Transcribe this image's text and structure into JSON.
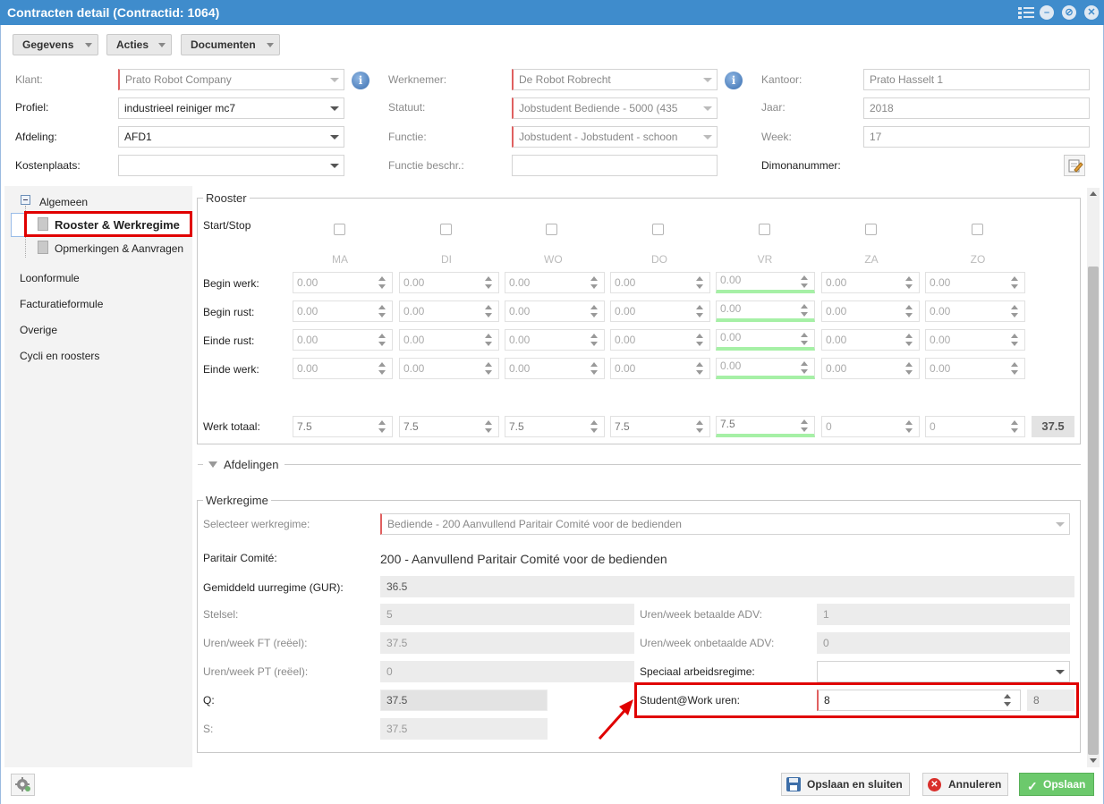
{
  "window": {
    "title": "Contracten detail (Contractid: 1064)"
  },
  "toolbar": {
    "gegevens": "Gegevens",
    "acties": "Acties",
    "documenten": "Documenten"
  },
  "form": {
    "klant_label": "Klant:",
    "klant_value": "Prato Robot Company",
    "profiel_label": "Profiel:",
    "profiel_value": "industrieel reiniger mc7",
    "afdeling_label": "Afdeling:",
    "afdeling_value": "AFD1",
    "kostenplaats_label": "Kostenplaats:",
    "kostenplaats_value": "",
    "werknemer_label": "Werknemer:",
    "werknemer_value": "De Robot Robrecht",
    "statuut_label": "Statuut:",
    "statuut_value": "Jobstudent Bediende - 5000 (435",
    "functie_label": "Functie:",
    "functie_value": "Jobstudent - Jobstudent - schoon",
    "functie_beschr_label": "Functie beschr.:",
    "functie_beschr_value": "",
    "kantoor_label": "Kantoor:",
    "kantoor_value": "Prato Hasselt 1",
    "jaar_label": "Jaar:",
    "jaar_value": "2018",
    "week_label": "Week:",
    "week_value": "17",
    "dimona_label": "Dimonanummer:"
  },
  "sidebar": {
    "algemeen": "Algemeen",
    "rooster": "Rooster & Werkregime",
    "opmerkingen": "Opmerkingen & Aanvragen",
    "loonformule": "Loonformule",
    "facturatieformule": "Facturatieformule",
    "overige": "Overige",
    "cycli": "Cycli en roosters"
  },
  "rooster": {
    "legend": "Rooster",
    "startstop_label": "Start/Stop",
    "days": [
      "MA",
      "DI",
      "WO",
      "DO",
      "VR",
      "ZA",
      "ZO"
    ],
    "begin_werk_label": "Begin werk:",
    "begin_rust_label": "Begin rust:",
    "einde_rust_label": "Einde rust:",
    "einde_werk_label": "Einde werk:",
    "werk_totaal_label": "Werk totaal:",
    "time_value": "0.00",
    "totals": [
      "7.5",
      "7.5",
      "7.5",
      "7.5",
      "7.5",
      "0",
      "0"
    ],
    "grand_total": "37.5"
  },
  "afdelingen": {
    "label": "Afdelingen"
  },
  "werkregime": {
    "legend": "Werkregime",
    "selecteer_label": "Selecteer werkregime:",
    "selecteer_value": "Bediende - 200 Aanvullend Paritair Comité voor de bedienden",
    "paritair_label": "Paritair Comité:",
    "paritair_value": "200 - Aanvullend Paritair Comité voor de bedienden",
    "gur_label": "Gemiddeld uurregime (GUR):",
    "gur_value": "36.5",
    "stelsel_label": "Stelsel:",
    "stelsel_value": "5",
    "ft_label": "Uren/week FT (reëel):",
    "ft_value": "37.5",
    "pt_label": "Uren/week PT (reëel):",
    "pt_value": "0",
    "q_label": "Q:",
    "q_value": "37.5",
    "s_label": "S:",
    "s_value": "37.5",
    "betaalde_adv_label": "Uren/week betaalde ADV:",
    "betaalde_adv_value": "1",
    "onbetaalde_adv_label": "Uren/week onbetaalde ADV:",
    "onbetaalde_adv_value": "0",
    "speciaal_label": "Speciaal arbeidsregime:",
    "speciaal_value": "",
    "student_label": "Student@Work uren:",
    "student_value": "8",
    "student_readonly": "8"
  },
  "footer": {
    "save_close": "Opslaan en sluiten",
    "cancel": "Annuleren",
    "save": "Opslaan"
  }
}
